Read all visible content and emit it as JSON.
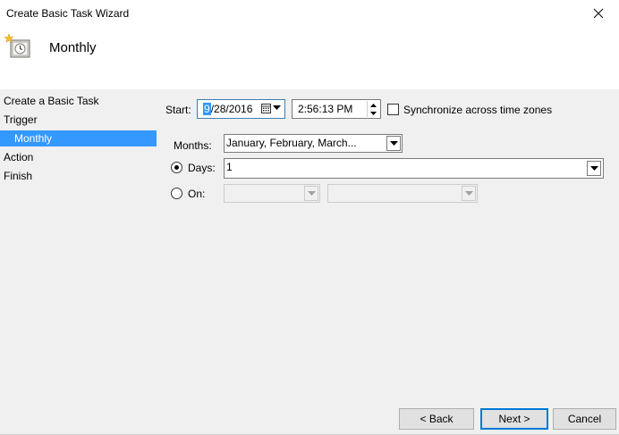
{
  "window": {
    "title": "Create Basic Task Wizard"
  },
  "header": {
    "title": "Monthly",
    "icon": "scheduled-task-clock-icon"
  },
  "nav": {
    "items": [
      {
        "label": "Create a Basic Task",
        "selected": false
      },
      {
        "label": "Trigger",
        "selected": false
      },
      {
        "label": "Monthly",
        "selected": true
      },
      {
        "label": "Action",
        "selected": false
      },
      {
        "label": "Finish",
        "selected": false
      }
    ]
  },
  "start": {
    "label": "Start:",
    "date_highlight": "9",
    "date_rest": "/28/2016",
    "time": "2:56:13 PM",
    "sync_label": "Synchronize across time zones",
    "sync_checked": false
  },
  "months": {
    "label": "Months:",
    "value": "January, February, March..."
  },
  "days": {
    "label": "Days:",
    "value": "1",
    "selected": true
  },
  "on": {
    "label": "On:",
    "selected": false,
    "value1": "",
    "value2": ""
  },
  "buttons": {
    "back": "< Back",
    "next": "Next >",
    "cancel": "Cancel"
  },
  "colors": {
    "accent": "#3399ff",
    "panel": "#f0f0f0",
    "default_border": "#0078d7"
  }
}
